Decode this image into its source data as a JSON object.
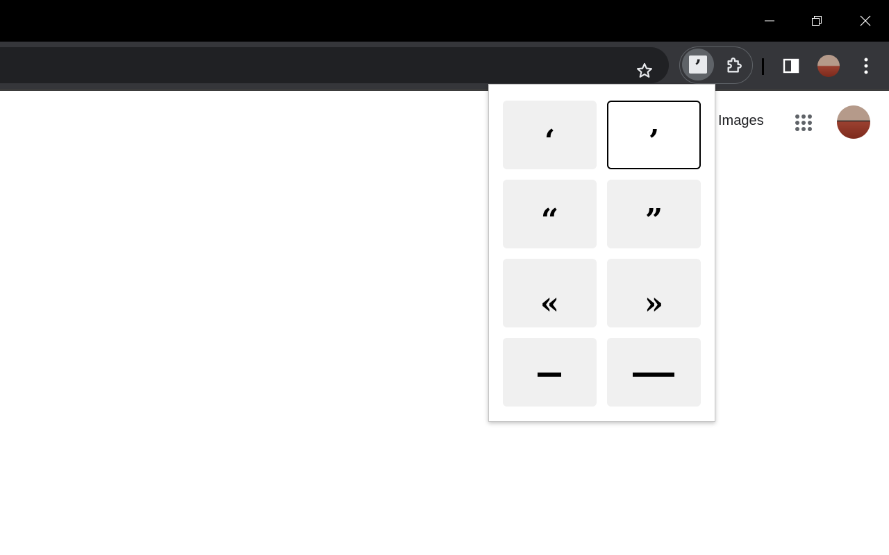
{
  "window_controls": {
    "minimize_icon": "minimize-icon",
    "restore_icon": "restore-icon",
    "close_icon": "close-icon"
  },
  "toolbar": {
    "bookmark_icon": "star-icon",
    "extension_icon": "quote-extension-icon",
    "extension_glyph": "’",
    "extensions_menu_icon": "puzzle-icon",
    "side_panel_icon": "side-panel-icon",
    "menu_icon": "vertical-dots-icon"
  },
  "page": {
    "images_link": "Images",
    "apps_icon": "apps-grid-icon"
  },
  "popup": {
    "buttons": [
      {
        "char": "‘",
        "name": "left-single-quote",
        "selected": false
      },
      {
        "char": "’",
        "name": "right-single-quote",
        "selected": true
      },
      {
        "char": "“",
        "name": "left-double-quote",
        "selected": false
      },
      {
        "char": "”",
        "name": "right-double-quote",
        "selected": false
      },
      {
        "char": "«",
        "name": "left-guillemet",
        "selected": false
      },
      {
        "char": "»",
        "name": "right-guillemet",
        "selected": false
      },
      {
        "char": "–",
        "name": "en-dash",
        "selected": false
      },
      {
        "char": "—",
        "name": "em-dash",
        "selected": false
      }
    ]
  },
  "colors": {
    "titlebar": "#000000",
    "toolbar": "#35363a",
    "omnibox": "#202124",
    "popup_button_bg": "#f0f0f0",
    "selected_border": "#000000"
  }
}
